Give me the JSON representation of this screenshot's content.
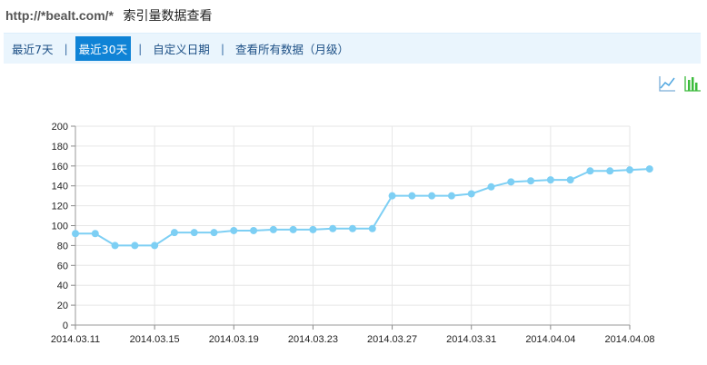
{
  "header": {
    "url": "http://*bealt.com/*",
    "title": "索引量数据查看"
  },
  "tabs": [
    {
      "label": "最近7天",
      "active": false
    },
    {
      "label": "最近30天",
      "active": true
    },
    {
      "label": "自定义日期",
      "active": false
    },
    {
      "label": "查看所有数据（月级）",
      "active": false
    }
  ],
  "tab_separator": "|",
  "chart_icons": [
    "line-chart-icon",
    "bar-chart-icon"
  ],
  "colors": {
    "series": "#7dcff4",
    "tab_active_bg": "#0f83d6",
    "tab_bar_bg": "#eaf5fd",
    "bar_icon": "#3cbb3c"
  },
  "chart_data": {
    "type": "line",
    "x": [
      "2014.03.11",
      "2014.03.12",
      "2014.03.13",
      "2014.03.14",
      "2014.03.15",
      "2014.03.16",
      "2014.03.17",
      "2014.03.18",
      "2014.03.19",
      "2014.03.20",
      "2014.03.21",
      "2014.03.22",
      "2014.03.23",
      "2014.03.24",
      "2014.03.25",
      "2014.03.26",
      "2014.03.27",
      "2014.03.28",
      "2014.03.29",
      "2014.03.30",
      "2014.03.31",
      "2014.04.01",
      "2014.04.02",
      "2014.04.03",
      "2014.04.04",
      "2014.04.05",
      "2014.04.06",
      "2014.04.07",
      "2014.04.08"
    ],
    "series": [
      {
        "values": [
          92,
          92,
          80,
          80,
          80,
          93,
          93,
          93,
          95,
          95,
          96,
          96,
          96,
          97,
          97,
          97,
          130,
          130,
          130,
          130,
          132,
          139,
          144,
          145,
          146,
          146,
          155,
          155,
          156,
          157
        ]
      }
    ],
    "x_tick_labels": [
      "2014.03.11",
      "2014.03.15",
      "2014.03.19",
      "2014.03.23",
      "2014.03.27",
      "2014.03.31",
      "2014.04.04",
      "2014.04.08"
    ],
    "y_ticks": [
      0,
      20,
      40,
      60,
      80,
      100,
      120,
      140,
      160,
      180,
      200
    ],
    "ylim": [
      0,
      200
    ],
    "grid": true,
    "legend": "none"
  }
}
